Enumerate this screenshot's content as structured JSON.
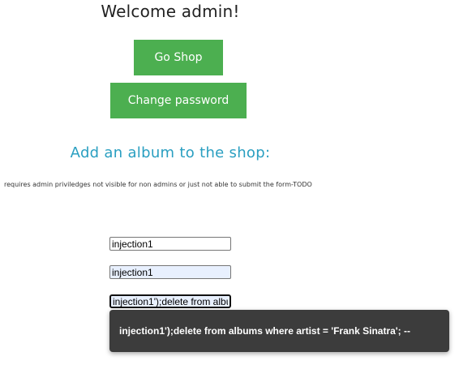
{
  "header": {
    "welcome_text": "Welcome admin!"
  },
  "buttons": {
    "go_shop_label": "Go Shop",
    "change_password_label": "Change password",
    "accent_color": "#4caf50"
  },
  "album_section": {
    "title": "Add an album to the shop:",
    "title_color": "#2a9fc1",
    "note": "requires admin priviledges not visible for non admins or just not able to submit the form-TODO"
  },
  "form": {
    "field_1_value": "injection1",
    "field_2_value": "injection1",
    "field_3_value": "injection1');delete from albu"
  },
  "autofill": {
    "suggestion": "injection1');delete from albums where artist = 'Frank Sinatra'; --"
  }
}
